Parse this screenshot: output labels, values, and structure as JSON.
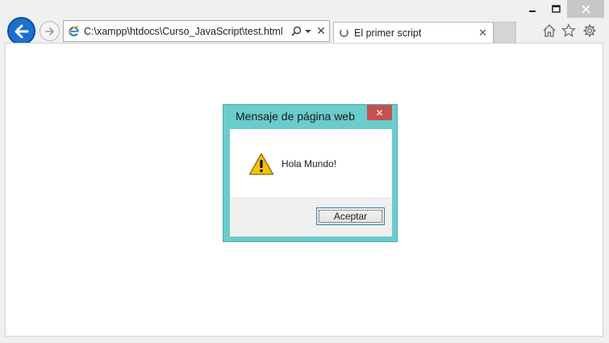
{
  "window": {
    "minimize_icon": "minimize-icon",
    "maximize_icon": "maximize-icon",
    "close_icon": "close-icon"
  },
  "navigation": {
    "back_icon": "back-arrow-icon",
    "forward_icon": "forward-arrow-icon"
  },
  "address_bar": {
    "url": "C:\\xampp\\htdocs\\Curso_JavaScript\\test.html",
    "site_icon": "ie-logo-icon",
    "search_icon": "search-icon",
    "dropdown_icon": "chevron-down-icon",
    "stop_glyph": "✕"
  },
  "tab": {
    "title": "El primer script",
    "close_glyph": "✕",
    "loading_icon": "loading-spinner-icon"
  },
  "toolbar": {
    "home_icon": "home-icon",
    "favorites_icon": "star-icon",
    "settings_icon": "gear-icon"
  },
  "dialog": {
    "title": "Mensaje de página web",
    "close_glyph": "✕",
    "icon": "warning-icon",
    "message": "Hola Mundo!",
    "ok_label": "Aceptar"
  },
  "colors": {
    "dialog_frame": "#6bcccc",
    "dialog_close": "#c75050",
    "back_button": "#1a6fcf"
  }
}
